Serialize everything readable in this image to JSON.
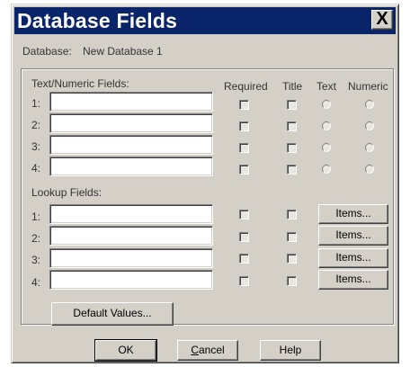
{
  "window": {
    "title": "Database Fields",
    "close_glyph": "X"
  },
  "database": {
    "label": "Database:",
    "name": "New Database 1"
  },
  "text_numeric": {
    "label": "Text/Numeric Fields:",
    "columns": {
      "required": "Required",
      "title": "Title",
      "text": "Text",
      "numeric": "Numeric"
    },
    "rows": [
      {
        "num": "1:",
        "value": ""
      },
      {
        "num": "2:",
        "value": ""
      },
      {
        "num": "3:",
        "value": ""
      },
      {
        "num": "4:",
        "value": ""
      }
    ]
  },
  "lookup": {
    "label": "Lookup Fields:",
    "items_label": "Items...",
    "rows": [
      {
        "num": "1:",
        "value": ""
      },
      {
        "num": "2:",
        "value": ""
      },
      {
        "num": "3:",
        "value": ""
      },
      {
        "num": "4:",
        "value": ""
      }
    ]
  },
  "buttons": {
    "default_values": "Default Values...",
    "ok": "OK",
    "cancel_underlined": "C",
    "cancel_rest": "ancel",
    "help": "Help"
  },
  "colors": {
    "titlebar": "#0a246a",
    "face": "#d4d0c8"
  }
}
